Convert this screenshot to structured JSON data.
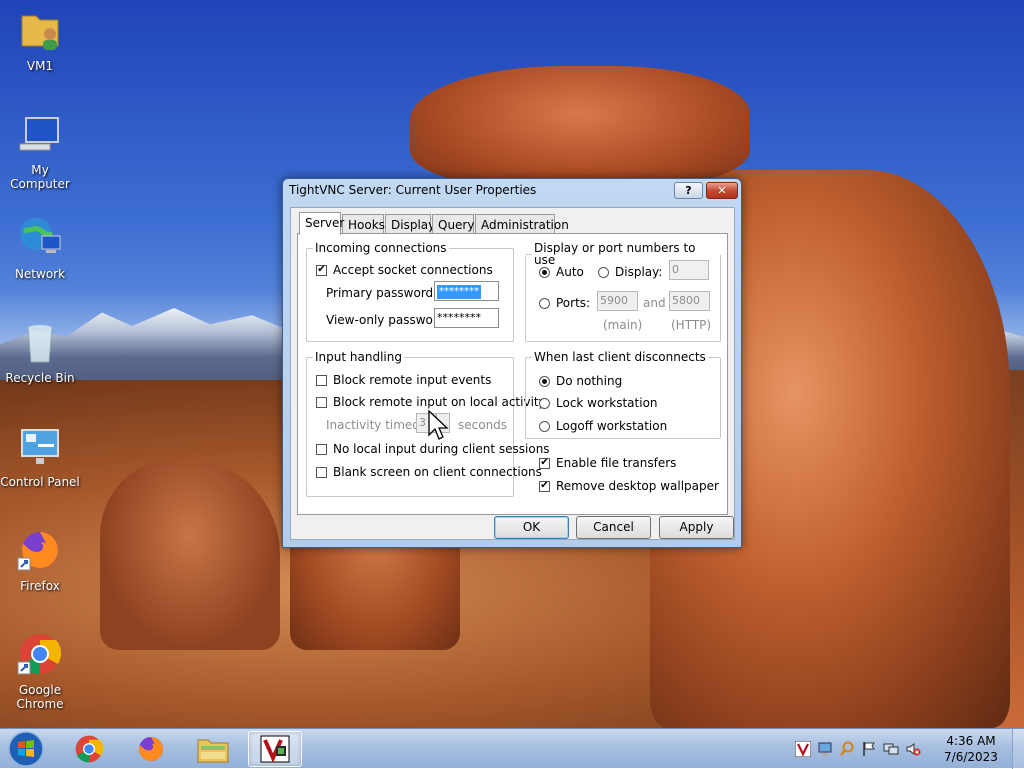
{
  "desktop": {
    "icons": [
      {
        "label": "VM1",
        "icon": "user-folder-icon"
      },
      {
        "label": "My Computer",
        "icon": "computer-icon"
      },
      {
        "label": "Network",
        "icon": "network-icon"
      },
      {
        "label": "Recycle Bin",
        "icon": "recycle-bin-icon"
      },
      {
        "label": "Control Panel",
        "icon": "control-panel-icon"
      },
      {
        "label": "Firefox",
        "icon": "firefox-icon"
      },
      {
        "label": "Google Chrome",
        "icon": "chrome-icon"
      }
    ]
  },
  "dialog": {
    "title": "TightVNC Server: Current User Properties",
    "help_button": "?",
    "close_button": "✕",
    "tabs": [
      "Server",
      "Hooks",
      "Display",
      "Query",
      "Administration"
    ],
    "selected_tab": "Server",
    "incoming": {
      "legend": "Incoming connections",
      "accept_label": "Accept socket connections",
      "accept_checked": true,
      "primary_label": "Primary password:",
      "primary_value": "********",
      "viewonly_label": "View-only password:",
      "viewonly_value": "********"
    },
    "display": {
      "legend": "Display or port numbers to use",
      "auto_label": "Auto",
      "display_label": "Display:",
      "display_value": "0",
      "ports_label": "Ports:",
      "port_main": "5900",
      "and_label": "and",
      "port_http": "5800",
      "main_caption": "(main)",
      "http_caption": "(HTTP)",
      "selected": "Auto"
    },
    "input": {
      "legend": "Input handling",
      "block_events_label": "Block remote input events",
      "block_local_label": "Block remote input on local activity",
      "inactivity_label": "Inactivity timeout:",
      "inactivity_value": "3",
      "seconds_label": "seconds",
      "no_local_label": "No local input during client sessions",
      "blank_screen_label": "Blank screen on client connections"
    },
    "disconnect": {
      "legend": "When last client disconnects",
      "options": [
        "Do nothing",
        "Lock workstation",
        "Logoff workstation"
      ],
      "selected": "Do nothing"
    },
    "enable_file_transfers": {
      "label": "Enable file transfers",
      "checked": true
    },
    "remove_wallpaper": {
      "label": "Remove desktop wallpaper",
      "checked": true
    },
    "buttons": {
      "ok": "OK",
      "cancel": "Cancel",
      "apply": "Apply"
    }
  },
  "taskbar": {
    "start": "start-orb-icon",
    "pinned": [
      "chrome-icon",
      "firefox-icon",
      "explorer-icon",
      "tightvnc-icon"
    ],
    "tray_icons": [
      "tightvnc-tray-icon",
      "network-share-icon",
      "search-icon",
      "flag-icon",
      "network-icon",
      "volume-muted-icon"
    ],
    "time": "4:36 AM",
    "date": "7/6/2023"
  },
  "colors": {
    "accent": "#3399ff",
    "taskbar": "#a7bfe0",
    "dialog_frame": "#c1d8f2"
  }
}
